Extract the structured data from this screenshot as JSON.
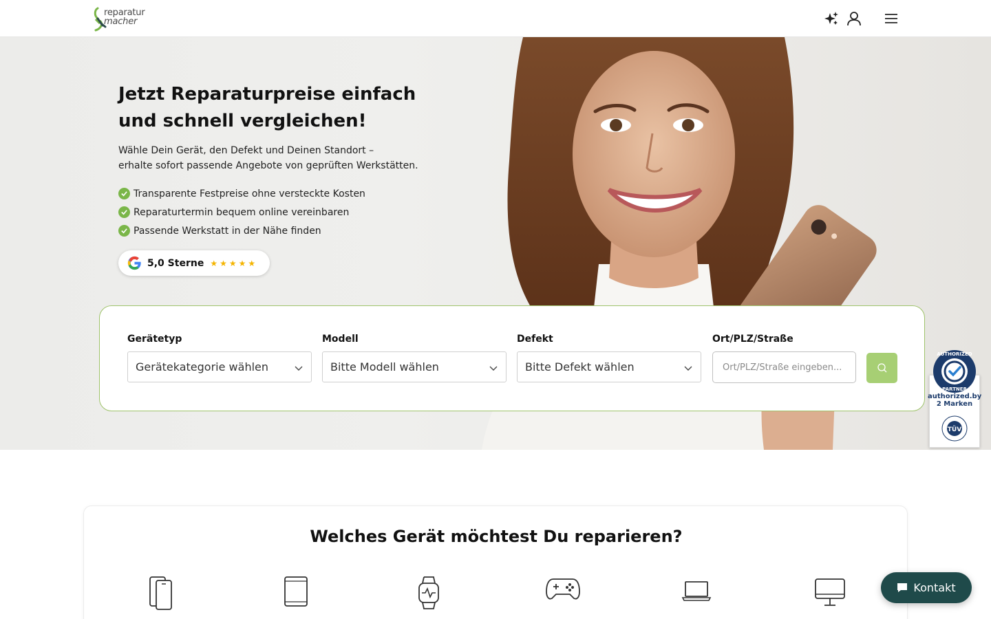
{
  "header": {
    "logo_line1": "reparatur",
    "logo_line2": "macher",
    "icons": [
      "sparkle-icon",
      "user-icon",
      "menu-icon"
    ]
  },
  "hero": {
    "title": "Jetzt Reparaturpreise einfach und schnell vergleichen!",
    "subtitle_line1": "Wähle Dein Gerät, den Defekt und Deinen Standort –",
    "subtitle_line2": "erhalte sofort passende Angebote von geprüften Werkstätten.",
    "bullets": [
      "Transparente Festpreise ohne versteckte Kosten",
      "Reparaturtermin bequem online vereinbaren",
      "Passende Werkstatt in der Nähe finden"
    ],
    "rating_text": "5,0 Sterne",
    "rating_stars": "★★★★★",
    "rating_value": 5
  },
  "search": {
    "device_label": "Gerätetyp",
    "device_value": "Gerätekategorie wählen",
    "model_label": "Modell",
    "model_value": "Bitte Modell wählen",
    "defect_label": "Defekt",
    "defect_value": "Bitte Defekt wählen",
    "location_label": "Ort/PLZ/Straße",
    "location_placeholder": "Ort/PLZ/Straße eingeben...",
    "location_value": ""
  },
  "badge": {
    "line1": "authorized.by",
    "line2": "2 Marken",
    "seal_top": "AUTHORIZED",
    "seal_bottom": "PARTNER",
    "tuv_text": "TÜV"
  },
  "devices": {
    "title": "Welches Gerät möchtest Du reparieren?",
    "icons": [
      "smartphone-icon",
      "tablet-icon",
      "smartwatch-icon",
      "gamepad-icon",
      "laptop-icon",
      "desktop-icon"
    ]
  },
  "contact": {
    "label": "Kontakt"
  },
  "colors": {
    "accent_green": "#7ab648",
    "search_button": "#a7cf74",
    "contact_button": "#1f4a4a",
    "card_border": "#9ec36a",
    "star": "#f4b400"
  }
}
